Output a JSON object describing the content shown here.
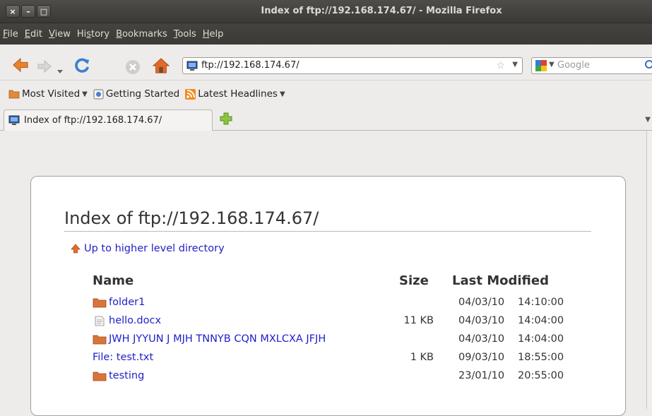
{
  "window": {
    "title": "Index of ftp://192.168.174.67/ - Mozilla Firefox",
    "close_label": "×",
    "minimize_label": "–",
    "maximize_label": "□"
  },
  "menu": {
    "items": [
      {
        "underline": "F",
        "rest": "ile"
      },
      {
        "underline": "E",
        "rest": "dit"
      },
      {
        "underline": "V",
        "rest": "iew"
      },
      {
        "prefix": "Hi",
        "underline": "s",
        "rest": "tory"
      },
      {
        "underline": "B",
        "rest": "ookmarks"
      },
      {
        "underline": "T",
        "rest": "ools"
      },
      {
        "underline": "H",
        "rest": "elp"
      }
    ]
  },
  "urlbar": {
    "value": "ftp://192.168.174.67/"
  },
  "search": {
    "placeholder": "Google"
  },
  "bookmarks": {
    "most_visited": "Most Visited",
    "getting_started": "Getting Started",
    "latest_headlines": "Latest Headlines"
  },
  "tab": {
    "label": "Index of ftp://192.168.174.67/"
  },
  "page": {
    "title": "Index of ftp://192.168.174.67/",
    "up_link": "Up to higher level directory",
    "headers": {
      "name": "Name",
      "size": "Size",
      "modified": "Last Modified"
    },
    "rows": [
      {
        "name": "folder1",
        "type": "folder",
        "size": "",
        "date": "04/03/10",
        "time": "14:10:00"
      },
      {
        "name": "hello.docx",
        "type": "file",
        "size": "11 KB",
        "date": "04/03/10",
        "time": "14:04:00"
      },
      {
        "name": "JWH JYYUN J MJH TNNYB CQN MXLCXA JFJH",
        "type": "folder",
        "size": "",
        "date": "04/03/10",
        "time": "14:04:00"
      },
      {
        "name": "File: test.txt",
        "type": "none",
        "size": "1 KB",
        "date": "09/03/10",
        "time": "18:55:00"
      },
      {
        "name": "testing",
        "type": "folder",
        "size": "",
        "date": "23/01/10",
        "time": "20:55:00"
      }
    ]
  },
  "colors": {
    "link": "#1f1fc8",
    "folder": "#d9743a",
    "titlebar": "#3c3b37"
  }
}
